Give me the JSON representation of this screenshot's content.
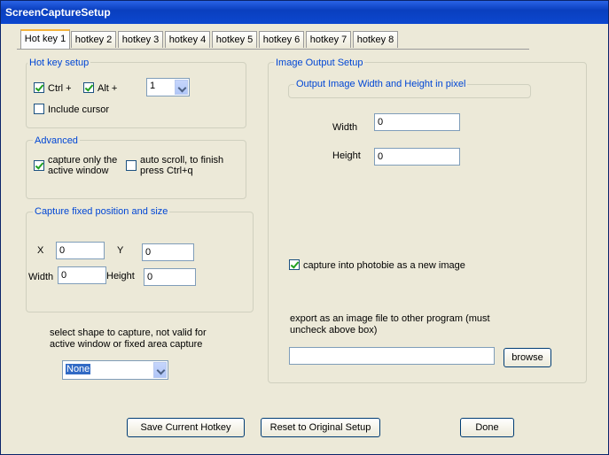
{
  "window": {
    "title": "ScreenCaptureSetup"
  },
  "tabs": [
    "Hot key 1",
    "hotkey 2",
    "hotkey 3",
    "hotkey 4",
    "hotkey 5",
    "hotkey 6",
    "hotkey 7",
    "hotkey 8"
  ],
  "hotkey_setup": {
    "title": "Hot key setup",
    "ctrl_label": "Ctrl +",
    "ctrl_checked": true,
    "alt_label": "Alt +",
    "alt_checked": true,
    "key_value": "1",
    "include_cursor_label": "Include cursor",
    "include_cursor_checked": false
  },
  "advanced": {
    "title": "Advanced",
    "active_window_label_1": "capture only the",
    "active_window_label_2": "active window",
    "active_window_checked": true,
    "auto_scroll_label_1": "auto scroll, to finish",
    "auto_scroll_label_2": "press Ctrl+q",
    "auto_scroll_checked": false
  },
  "fixed": {
    "title": "Capture fixed position and size",
    "x_label": "X",
    "x_value": "0",
    "y_label": "Y",
    "y_value": "0",
    "width_label": "Width",
    "width_value": "0",
    "height_label": "Height",
    "height_value": "0"
  },
  "shape": {
    "label_1": "select shape to capture, not valid for",
    "label_2": "active window or fixed area capture",
    "value": "None"
  },
  "output": {
    "title": "Image Output Setup",
    "size_title": "Output Image Width and Height in pixel",
    "width_label": "Width",
    "width_value": "0",
    "height_label": "Height",
    "height_value": "0",
    "photobie_label": "capture into photobie as a new image",
    "photobie_checked": true,
    "export_label_1": "export as an image file to other program (must",
    "export_label_2": "uncheck above box)",
    "export_value": "",
    "browse_label": "browse"
  },
  "buttons": {
    "save": "Save Current Hotkey",
    "reset": "Reset to Original Setup",
    "done": "Done"
  }
}
